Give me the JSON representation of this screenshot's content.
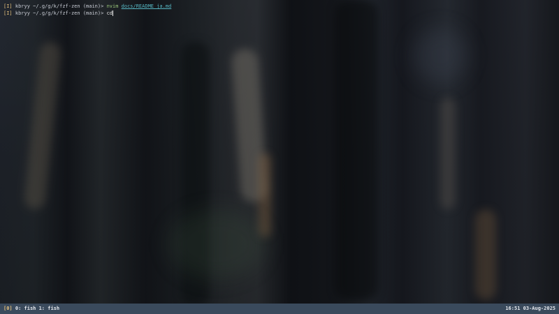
{
  "terminal": {
    "lines": [
      {
        "session": "[I]",
        "user": "kbryy",
        "path": "~/.g/g/k/fzf-zen",
        "branch": "(main)>",
        "command": "nvim",
        "argument": "docs/README_ja.md"
      },
      {
        "session": "[I]",
        "user": "kbryy",
        "path": "~/.g/g/k/fzf-zen",
        "branch": "(main)>",
        "typed": "cd"
      }
    ]
  },
  "statusbar": {
    "session": "[0]",
    "windows": "0: fish 1: fish",
    "time": "16:51",
    "date": "03-Aug-2025"
  },
  "colors": {
    "statusbar_bg": "#3a4a5c",
    "prompt_marker": "#e5c07b",
    "command": "#98c379",
    "argument": "#56b6c2"
  }
}
